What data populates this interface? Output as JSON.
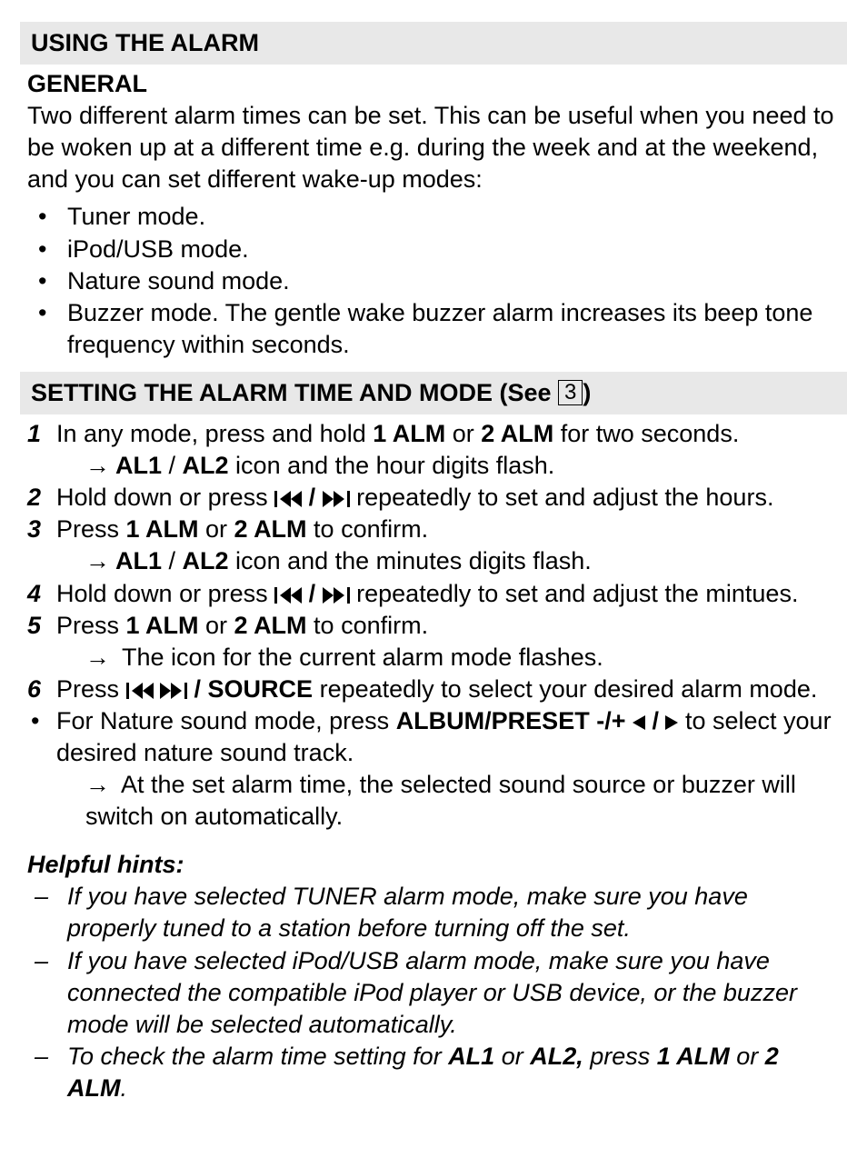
{
  "sections": {
    "using_alarm_title": "USING THE ALARM",
    "general_head": "GENERAL",
    "general_para": "Two different alarm times can be set. This can be useful when you need to be woken up at a different time e.g. during the week and at the weekend, and you can set different wake-up modes:",
    "modes": [
      "Tuner mode.",
      "iPod/USB mode.",
      "Nature sound mode.",
      "Buzzer mode. The gentle wake buzzer alarm increases its beep tone frequency within seconds."
    ],
    "setting_title_a": "SETTING THE ALARM TIME AND MODE  (See ",
    "setting_title_box": "3",
    "setting_title_b": ")",
    "steps": {
      "s1a": "In any mode, press and hold ",
      "s1b": "1 ALM",
      "s1c": " or ",
      "s1d": "2 ALM",
      "s1e": " for two seconds.",
      "r1a": "AL1",
      "r1b": " / ",
      "r1c": "AL2",
      "r1d": " icon and the hour digits flash.",
      "s2a": "Hold down or press ",
      "s2sep": " / ",
      "s2b": " repeatedly to set and adjust the hours.",
      "s3a": "Press ",
      "s3b": "1 ALM",
      "s3c": " or ",
      "s3d": "2 ALM",
      "s3e": " to confirm.",
      "r3a": "AL1",
      "r3b": " / ",
      "r3c": "AL2",
      "r3d": " icon and the minutes digits flash.",
      "s4a": "Hold down or press ",
      "s4sep": " / ",
      "s4b": " repeatedly to set and adjust the mintues.",
      "s5a": "Press ",
      "s5b": "1 ALM",
      "s5c": " or ",
      "s5d": "2 ALM",
      "s5e": " to confirm.",
      "r5": " The icon for the current alarm mode flashes.",
      "s6a": "Press ",
      "s6sep1": "  ",
      "s6src": " / SOURCE",
      "s6b": " repeatedly to select your desired alarm mode.",
      "s6blt_a": "For Nature sound mode, press ",
      "s6blt_b": "ALBUM/PRESET -/+ ",
      "s6blt_sep": " / ",
      "s6blt_c": " to select your desired nature sound track.",
      "r6": " At the set alarm time, the selected sound source or buzzer will switch on automatically."
    },
    "hints_title": "Helpful hints:",
    "hints": {
      "h1": "If you have selected TUNER alarm mode, make sure you have properly tuned to a station before turning off the set.",
      "h2": "If you have selected iPod/USB alarm mode, make sure you have connected the compatible iPod player or USB device, or the buzzer mode will be selected automatically.",
      "h3a": "To check the alarm time setting for ",
      "h3b": "AL1",
      "h3c": " or ",
      "h3d": "AL2,",
      "h3e": " press ",
      "h3f": "1 ALM",
      "h3g": " or ",
      "h3h": "2 ALM",
      "h3i": "."
    }
  }
}
